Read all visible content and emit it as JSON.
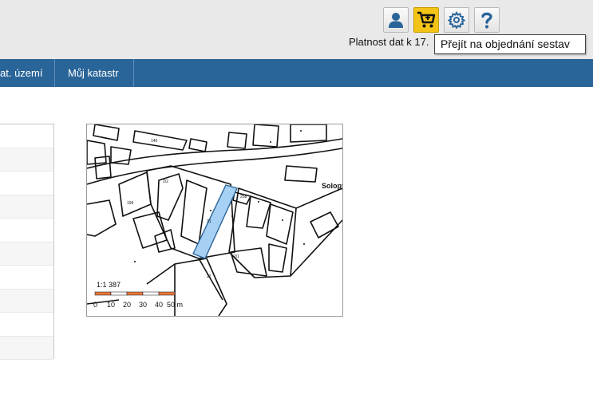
{
  "header": {
    "validity_text": "Platnost dat k 17.",
    "tooltip": "Přejít na objednání sestav",
    "icons": [
      "user-icon",
      "cart-icon",
      "gear-icon",
      "help-icon"
    ],
    "accent_color": "#f3c316"
  },
  "navbar": {
    "color": "#2a6599",
    "items": [
      {
        "label": "at. území"
      },
      {
        "label": "Můj katastr"
      }
    ]
  },
  "map": {
    "scale_text": "1:1 387",
    "scale_ticks": [
      "0",
      "10",
      "20",
      "30",
      "40",
      "50 m"
    ],
    "place_label": "Solopy",
    "highlight_color": "#a7d0f5",
    "parcel_labels": [
      "31",
      "2/1",
      "258",
      "22",
      "199",
      "2/2",
      "140"
    ]
  }
}
